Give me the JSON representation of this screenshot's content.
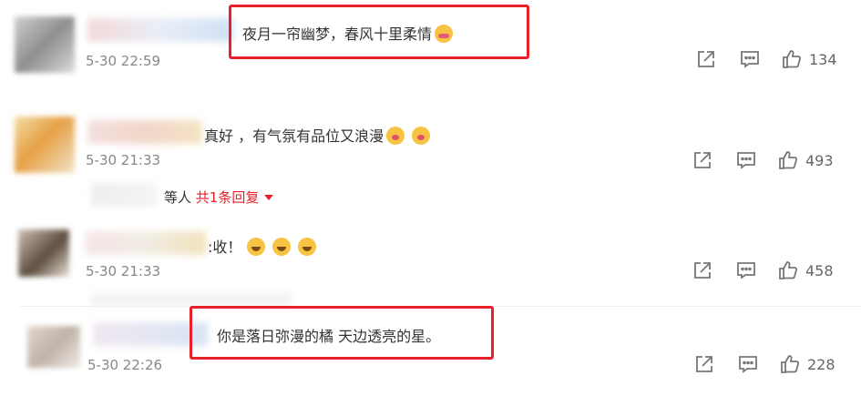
{
  "comments": [
    {
      "text": "夜月一帘幽梦，春风十里柔情",
      "emojis": [
        "cry-icon"
      ],
      "time": "5-30 22:59",
      "likes": "134",
      "avatar_colors": [
        "#c9c9c9",
        "#8c8c8c",
        "#d8d8d8"
      ],
      "highlighted": true
    },
    {
      "text": "真好 ，有气氛有品位又浪漫",
      "emojis": [
        "kiss-icon",
        "kiss-icon"
      ],
      "time": "5-30 21:33",
      "likes": "493",
      "avatar_colors": [
        "#f0d79a",
        "#e8a54a",
        "#f3e4c6"
      ],
      "highlighted": false
    },
    {
      "text": ":收！",
      "emojis": [
        "grin-icon",
        "grin-icon",
        "grin-icon"
      ],
      "time": "5-30 21:33",
      "likes": "458",
      "avatar_colors": [
        "#b9aea4",
        "#6d5c4a",
        "#e8e0d8"
      ],
      "highlighted": false
    },
    {
      "text": "你是落日弥漫的橘 天边透亮的星。",
      "emojis": [],
      "time": "5-30 22:26",
      "likes": "228",
      "avatar_colors": [
        "#d9cfc6",
        "#bfb2a8",
        "#ede7e2"
      ],
      "highlighted": true
    }
  ],
  "reply_summary": {
    "prefix": "等人",
    "link": "共1条回复"
  },
  "accent_color": "#e8202a"
}
